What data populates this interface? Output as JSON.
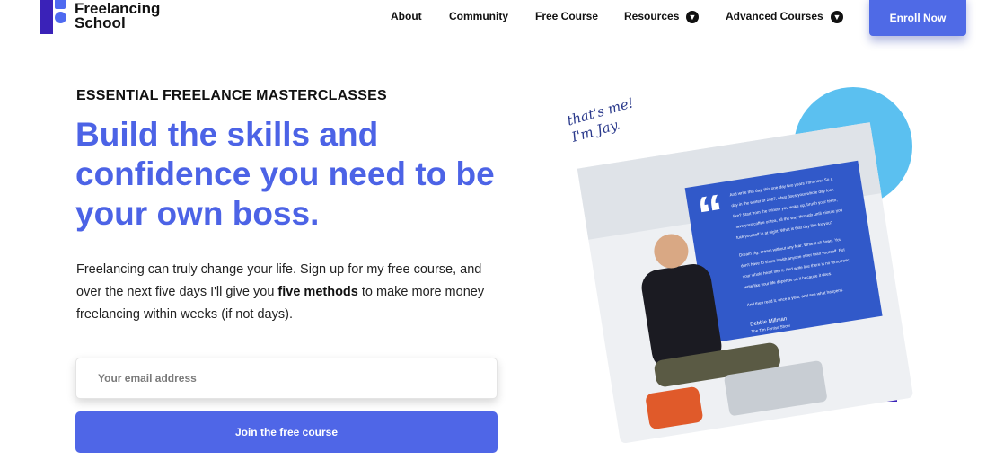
{
  "brand": {
    "name": "Freelancing\nSchool"
  },
  "nav": {
    "items": [
      {
        "label": "About"
      },
      {
        "label": "Community"
      },
      {
        "label": "Free Course"
      },
      {
        "label": "Resources"
      },
      {
        "label": "Advanced Courses"
      }
    ],
    "cta": "Enroll Now"
  },
  "hero": {
    "eyebrow": "ESSENTIAL FREELANCE MASTERCLASSES",
    "headline": "Build the skills and confidence you need to be your own boss.",
    "body_before": "Freelancing can truly change your life. Sign up for my free course, and over the next five days I'll give you ",
    "body_bold": "five methods",
    "body_after": " to make more money freelancing within weeks (if not days).",
    "email_placeholder": "Your email address",
    "submit": "Join the free course",
    "annotation": "that's me!\nI'm Jay.",
    "slide_lines": [
      "And write this day, this one day two years from now. So a",
      "day in the winter of 2027, what does your whole day look",
      "like? Start from the minute you wake up, brush your teeth,",
      "have your coffee or tea, all the way through until minute you",
      "tuck yourself in at night. What is that day like for you?",
      "Dream big, dream without any fear. Write it all down. You",
      "don't have to share it with anyone other than yourself. Put",
      "your whole heart into it. And write like there is no tomorrow;",
      "write like your life depends on it because it does.",
      "And then read it, once a year, and see what happens."
    ],
    "slide_author": "Debbie Millman",
    "slide_source": "The Tim Ferriss Show"
  },
  "colors": {
    "accent": "#4c63e6",
    "brand_dark": "#3a22b8"
  }
}
